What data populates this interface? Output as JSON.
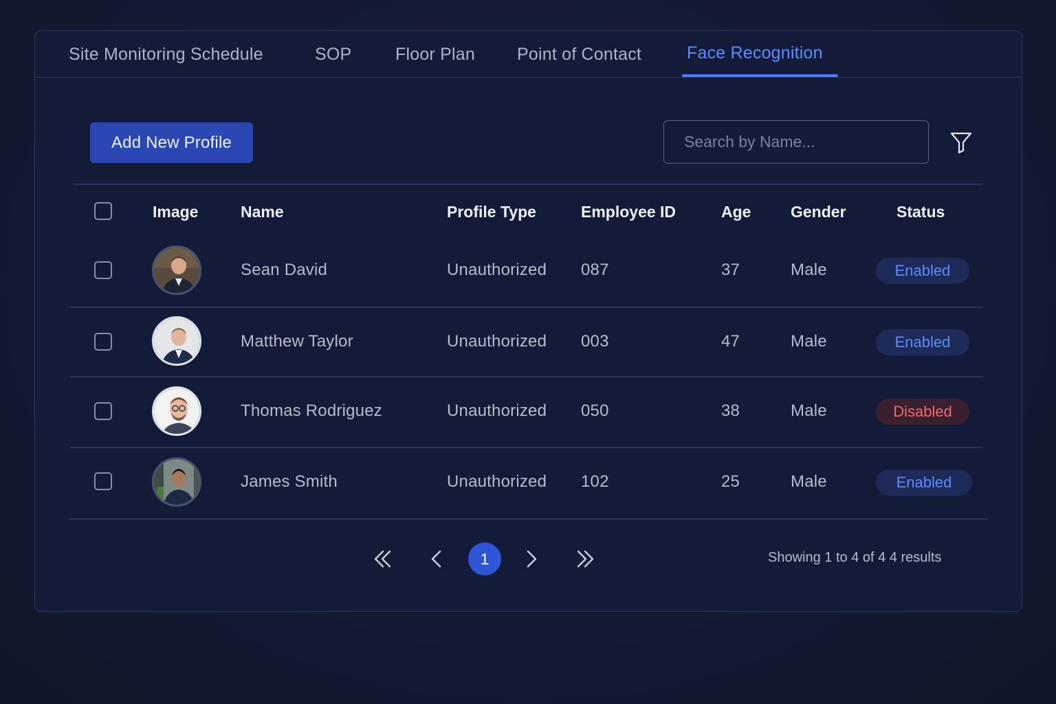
{
  "tabs": [
    {
      "label": "Site Monitoring Schedule",
      "active": false
    },
    {
      "label": "SOP",
      "active": false
    },
    {
      "label": "Floor Plan",
      "active": false
    },
    {
      "label": "Point of Contact",
      "active": false
    },
    {
      "label": "Face Recognition",
      "active": true
    }
  ],
  "toolbar": {
    "add_label": "Add New Profile",
    "search_placeholder": "Search by Name...",
    "filter_icon": "filter-icon"
  },
  "table": {
    "headers": [
      "Image",
      "Name",
      "Profile Type",
      "Employee ID",
      "Age",
      "Gender",
      "Status"
    ],
    "rows": [
      {
        "name": "Sean David",
        "profile_type": "Unauthorized",
        "employee_id": "087",
        "age": "37",
        "gender": "Male",
        "status": "Enabled"
      },
      {
        "name": "Matthew Taylor",
        "profile_type": "Unauthorized",
        "employee_id": "003",
        "age": "47",
        "gender": "Male",
        "status": "Enabled"
      },
      {
        "name": "Thomas Rodriguez",
        "profile_type": "Unauthorized",
        "employee_id": "050",
        "age": "38",
        "gender": "Male",
        "status": "Disabled"
      },
      {
        "name": "James Smith",
        "profile_type": "Unauthorized",
        "employee_id": "102",
        "age": "25",
        "gender": "Male",
        "status": "Enabled"
      }
    ]
  },
  "pagination": {
    "current_page": "1",
    "summary": "Showing 1 to 4 of 4 4 results"
  },
  "colors": {
    "accent": "#4b7cf5",
    "enabled": "#5c8dff",
    "disabled": "#f06a6a",
    "background": "#141b38"
  }
}
